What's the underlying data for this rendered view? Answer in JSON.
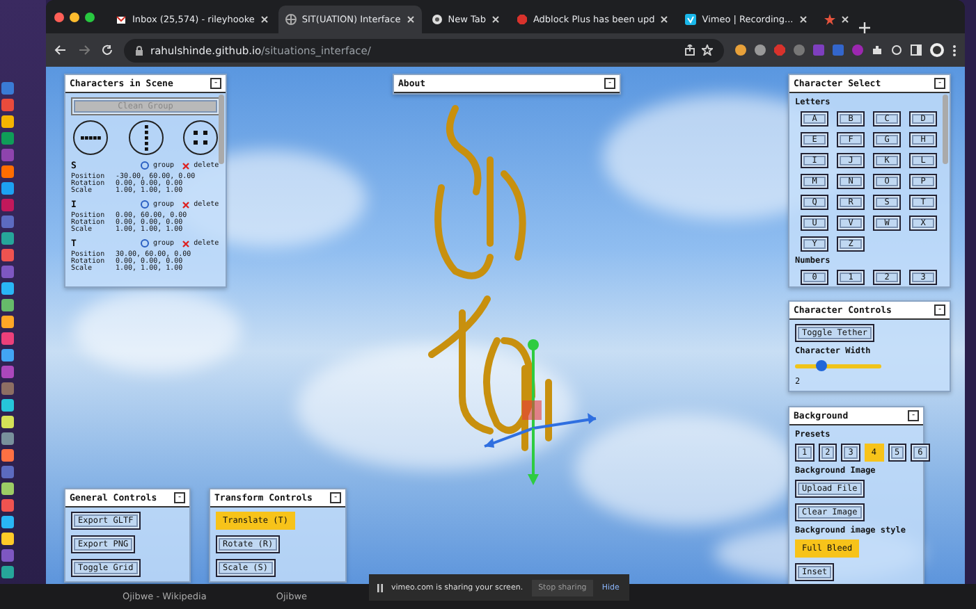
{
  "browser": {
    "tabs": [
      {
        "title": "Inbox (25,574) - rileyhooke",
        "selected": false
      },
      {
        "title": "SIT(UATION) Interface",
        "selected": true
      },
      {
        "title": "New Tab",
        "selected": false
      },
      {
        "title": "Adblock Plus has been upd",
        "selected": false
      },
      {
        "title": "Vimeo | Recording...",
        "selected": false
      },
      {
        "selected": false
      }
    ],
    "address": {
      "host": "rahulshinde.github.io",
      "path": "/situations_interface/"
    }
  },
  "panels": {
    "characters": {
      "title": "Characters in Scene",
      "collapse": "-",
      "clear_button": {
        "label": "Clean Group",
        "disabled": true
      },
      "items": [
        {
          "letter": "S",
          "group_label": "group",
          "grouped": false,
          "delete_label": "delete",
          "transform": [
            {
              "label": "Position",
              "value": "-30.00, 60.00, 0.00"
            },
            {
              "label": "Rotation",
              "value": "0.00, 0.00, 0.00"
            },
            {
              "label": "Scale",
              "value": "1.00, 1.00, 1.00"
            }
          ]
        },
        {
          "letter": "I",
          "group_label": "group",
          "grouped": false,
          "delete_label": "delete",
          "transform": [
            {
              "label": "Position",
              "value": "0.00, 60.00, 0.00"
            },
            {
              "label": "Rotation",
              "value": "0.00, 0.00, 0.00"
            },
            {
              "label": "Scale",
              "value": "1.00, 1.00, 1.00"
            }
          ]
        },
        {
          "letter": "T",
          "group_label": "group",
          "grouped": false,
          "delete_label": "delete",
          "transform": [
            {
              "label": "Position",
              "value": "30.00, 60.00, 0.00"
            },
            {
              "label": "Rotation",
              "value": "0.00, 0.00, 0.00"
            },
            {
              "label": "Scale",
              "value": "1.00, 1.00, 1.00"
            }
          ]
        }
      ]
    },
    "about": {
      "title": "About",
      "collapse": "-"
    },
    "character_select": {
      "title": "Character Select",
      "collapse": "-",
      "sections": [
        {
          "heading": "Letters",
          "keys": [
            "A",
            "B",
            "C",
            "D",
            "E",
            "F",
            "G",
            "H",
            "I",
            "J",
            "K",
            "L",
            "M",
            "N",
            "O",
            "P",
            "Q",
            "R",
            "S",
            "T",
            "U",
            "V",
            "W",
            "X",
            "Y",
            "Z"
          ]
        },
        {
          "heading": "Numbers",
          "keys": [
            "0",
            "1",
            "2",
            "3"
          ]
        }
      ]
    },
    "character_controls": {
      "title": "Character Controls",
      "collapse": "-",
      "toggle_button": "Toggle Tether",
      "width_label": "Character Width",
      "width_slider": {
        "level": 0.3
      },
      "width_value": "2"
    },
    "background": {
      "title": "Background",
      "collapse": "-",
      "presets_label": "Presets",
      "presets": [
        {
          "label": "1",
          "selected": false
        },
        {
          "label": "2",
          "selected": false
        },
        {
          "label": "3",
          "selected": false
        },
        {
          "label": "4",
          "selected": true
        },
        {
          "label": "5",
          "selected": false
        },
        {
          "label": "6",
          "selected": false
        }
      ],
      "image_label": "Background Image",
      "image_buttons": [
        "Upload File",
        "Clear Image"
      ],
      "style_label": "Background image style",
      "styles": [
        {
          "label": "Full Bleed",
          "selected": true
        },
        {
          "label": "Inset",
          "selected": false
        }
      ]
    },
    "general_controls": {
      "title": "General Controls",
      "collapse": "-",
      "buttons": [
        "Export GLTF",
        "Export PNG",
        "Toggle Grid"
      ]
    },
    "transform_controls": {
      "title": "Transform Controls",
      "collapse": "-",
      "modes": [
        {
          "label": "Translate (T)",
          "selected": true
        },
        {
          "label": "Rotate (R)",
          "selected": false
        },
        {
          "label": "Scale (S)",
          "selected": false
        }
      ]
    }
  },
  "share_bar": {
    "message": "vimeo.com is sharing your screen.",
    "stop": "Stop sharing",
    "hide": "Hide"
  },
  "taskbar": {
    "items": [
      "Ojibwe - Wikipedia",
      "Ojibwe"
    ]
  }
}
